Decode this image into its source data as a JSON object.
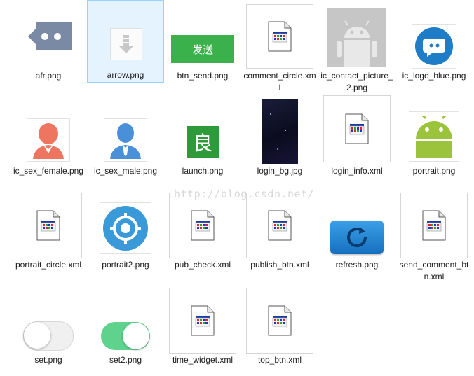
{
  "watermark": "http://blog.csdn.net/",
  "files": [
    {
      "name": "afr.png"
    },
    {
      "name": "arrow.png"
    },
    {
      "name": "btn_send.png",
      "text": "发送"
    },
    {
      "name": "comment_circle.xml"
    },
    {
      "name": "ic_contact_picture_2.png"
    },
    {
      "name": "ic_logo_blue.png"
    },
    {
      "name": "ic_sex_female.png"
    },
    {
      "name": "ic_sex_male.png"
    },
    {
      "name": "launch.png",
      "text": "良"
    },
    {
      "name": "login_bg.jpg"
    },
    {
      "name": "login_info.xml"
    },
    {
      "name": "portrait.png"
    },
    {
      "name": "portrait_circle.xml"
    },
    {
      "name": "portrait2.png"
    },
    {
      "name": "pub_check.xml"
    },
    {
      "name": "publish_btn.xml"
    },
    {
      "name": "refresh.png"
    },
    {
      "name": "send_comment_btn.xml"
    },
    {
      "name": "set.png"
    },
    {
      "name": "set2.png"
    },
    {
      "name": "time_widget.xml"
    },
    {
      "name": "top_btn.xml"
    }
  ],
  "colors": {
    "selection_bg": "#e5f3ff",
    "selection_border": "#99d1ff",
    "android_green": "#9bc33c",
    "blue": "#1f7dc8",
    "send_green": "#3bb14b"
  }
}
